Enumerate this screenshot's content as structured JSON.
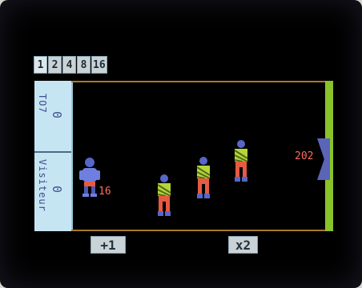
{
  "multipliers": [
    {
      "label": "1"
    },
    {
      "label": "2"
    },
    {
      "label": "4"
    },
    {
      "label": "8"
    },
    {
      "label": "16"
    }
  ],
  "teams": {
    "home": {
      "name": "TO7",
      "score": "0"
    },
    "visitor": {
      "name": "Visiteur",
      "score": "0"
    }
  },
  "field": {
    "target_value": "202",
    "player_number": "16"
  },
  "buttons": {
    "plus_one": "+1",
    "times_two": "x2"
  },
  "colors": {
    "panel": "#c6e5f3",
    "goal": "#8ac22a",
    "score_text": "#ff6b5a",
    "field_line": "#a77a2a"
  }
}
